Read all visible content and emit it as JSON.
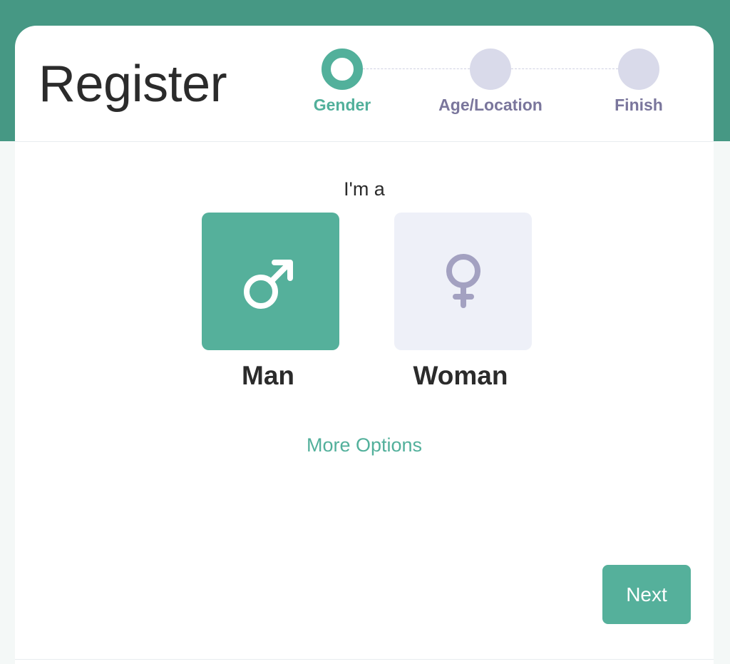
{
  "header": {
    "title": "Register"
  },
  "stepper": {
    "steps": [
      {
        "label": "Gender",
        "state": "active"
      },
      {
        "label": "Age/Location",
        "state": "inactive"
      },
      {
        "label": "Finish",
        "state": "inactive"
      }
    ]
  },
  "form": {
    "prompt": "I'm a",
    "options": [
      {
        "label": "Man",
        "icon": "male-symbol-icon",
        "selected": true
      },
      {
        "label": "Woman",
        "icon": "female-symbol-icon",
        "selected": false
      }
    ],
    "more_options": "More Options",
    "next_label": "Next"
  },
  "colors": {
    "brand": "#469884",
    "accent": "#55b09b",
    "inactive_step": "#d9daea",
    "inactive_label": "#7a769c",
    "unselected_tile": "#eef0f8",
    "unselected_icon": "#a3a1c1"
  }
}
